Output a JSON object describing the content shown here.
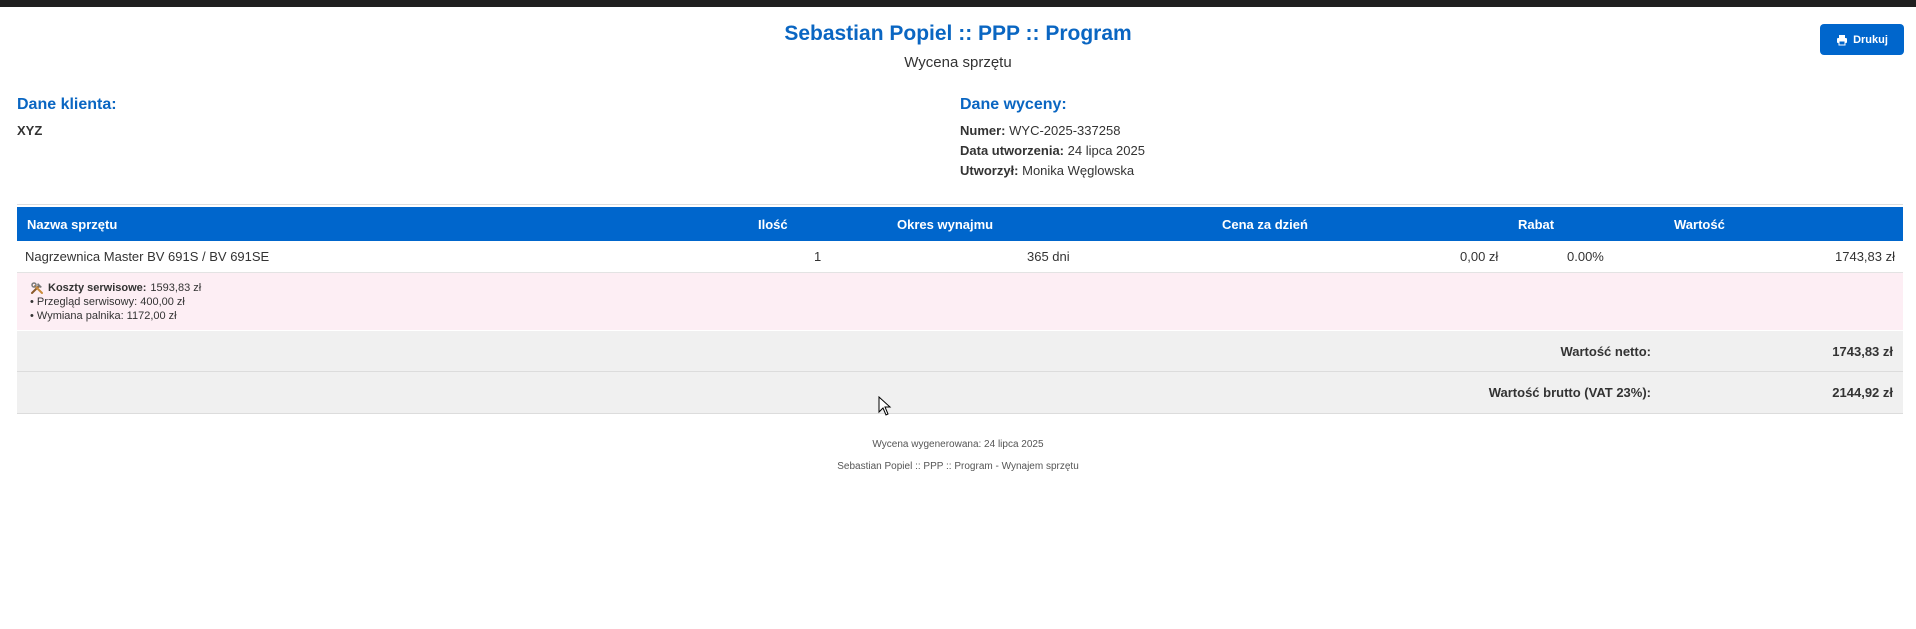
{
  "header": {
    "title": "Sebastian Popiel :: PPP :: Program",
    "subtitle": "Wycena sprzętu",
    "print_label": "Drukuj"
  },
  "client": {
    "heading": "Dane klienta:",
    "name": "XYZ"
  },
  "quote": {
    "heading": "Dane wyceny:",
    "number_label": "Numer:",
    "number": "WYC-2025-337258",
    "created_label": "Data utworzenia:",
    "created": "24 lipca 2025",
    "author_label": "Utworzył:",
    "author": "Monika Węglowska"
  },
  "table": {
    "headers": [
      "Nazwa sprzętu",
      "Ilość",
      "Okres wynajmu",
      "Cena za dzień",
      "Rabat",
      "Wartość"
    ],
    "rows": [
      {
        "name": "Nagrzewnica Master BV 691S / BV 691SE",
        "qty": "1",
        "period": "365 dni",
        "price_per_day": "0,00 zł",
        "discount": "0.00%",
        "value": "1743,83 zł"
      }
    ]
  },
  "service": {
    "label": "Koszty serwisowe:",
    "total": "1593,83 zł",
    "items": [
      "• Przegląd serwisowy: 400,00 zł",
      "• Wymiana palnika: 1172,00 zł"
    ]
  },
  "totals": {
    "net_label": "Wartość netto:",
    "net": "1743,83 zł",
    "gross_label": "Wartość brutto (VAT 23%):",
    "gross": "2144,92 zł"
  },
  "footer": {
    "generated": "Wycena wygenerowana: 24 lipca 2025",
    "credit": "Sebastian Popiel :: PPP :: Program - Wynajem sprzętu"
  },
  "colors": {
    "accent": "#0066cc",
    "service_bg": "#fdeef4",
    "totals_bg": "#f0f0f0"
  }
}
